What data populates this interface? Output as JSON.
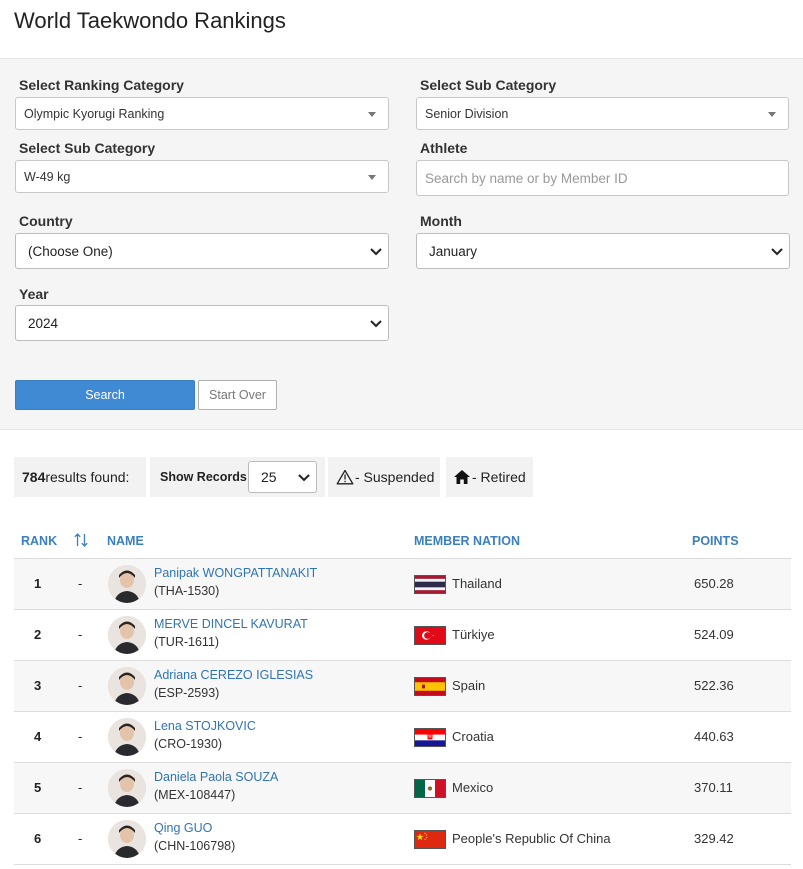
{
  "page": {
    "title": "World Taekwondo Rankings"
  },
  "filters": {
    "ranking_category": {
      "label": "Select Ranking Category",
      "value": "Olympic Kyorugi Ranking"
    },
    "sub_category_1": {
      "label": "Select Sub Category",
      "value": "Senior Division"
    },
    "sub_category_2": {
      "label": "Select Sub Category",
      "value": "W-49 kg"
    },
    "athlete": {
      "label": "Athlete",
      "placeholder": "Search by name or by Member ID"
    },
    "country": {
      "label": "Country",
      "value": "(Choose One)"
    },
    "month": {
      "label": "Month",
      "value": "January"
    },
    "year": {
      "label": "Year",
      "value": "2024"
    },
    "search_label": "Search",
    "start_over_label": "Start Over"
  },
  "results": {
    "count": "784",
    "count_suffix": " results found:",
    "show_records_label": "Show Records:",
    "show_records_value": "25",
    "suspended_label": "- Suspended",
    "retired_label": "- Retired"
  },
  "table": {
    "headers": {
      "rank": "RANK",
      "name": "NAME",
      "nation": "MEMBER NATION",
      "points": "POINTS"
    },
    "rows": [
      {
        "rank": "1",
        "movement": "-",
        "name": "Panipak WONGPATTANAKIT",
        "member_id": "(THA-1530)",
        "nation": "Thailand",
        "points": "650.28",
        "flag": "thailand"
      },
      {
        "rank": "2",
        "movement": "-",
        "name": "MERVE DINCEL KAVURAT",
        "member_id": "(TUR-1611)",
        "nation": "Türkiye",
        "points": "524.09",
        "flag": "turkiye"
      },
      {
        "rank": "3",
        "movement": "-",
        "name": "Adriana CEREZO IGLESIAS",
        "member_id": "(ESP-2593)",
        "nation": "Spain",
        "points": "522.36",
        "flag": "spain"
      },
      {
        "rank": "4",
        "movement": "-",
        "name": "Lena STOJKOVIC",
        "member_id": "(CRO-1930)",
        "nation": "Croatia",
        "points": "440.63",
        "flag": "croatia"
      },
      {
        "rank": "5",
        "movement": "-",
        "name": "Daniela Paola SOUZA",
        "member_id": "(MEX-108447)",
        "nation": "Mexico",
        "points": "370.11",
        "flag": "mexico"
      },
      {
        "rank": "6",
        "movement": "-",
        "name": "Qing GUO",
        "member_id": "(CHN-106798)",
        "nation": "People's Republic Of China",
        "points": "329.42",
        "flag": "china"
      }
    ]
  },
  "colors": {
    "accent": "#3f8ad3",
    "link": "#2f74b5",
    "panel_bg": "#f5f5f5"
  }
}
